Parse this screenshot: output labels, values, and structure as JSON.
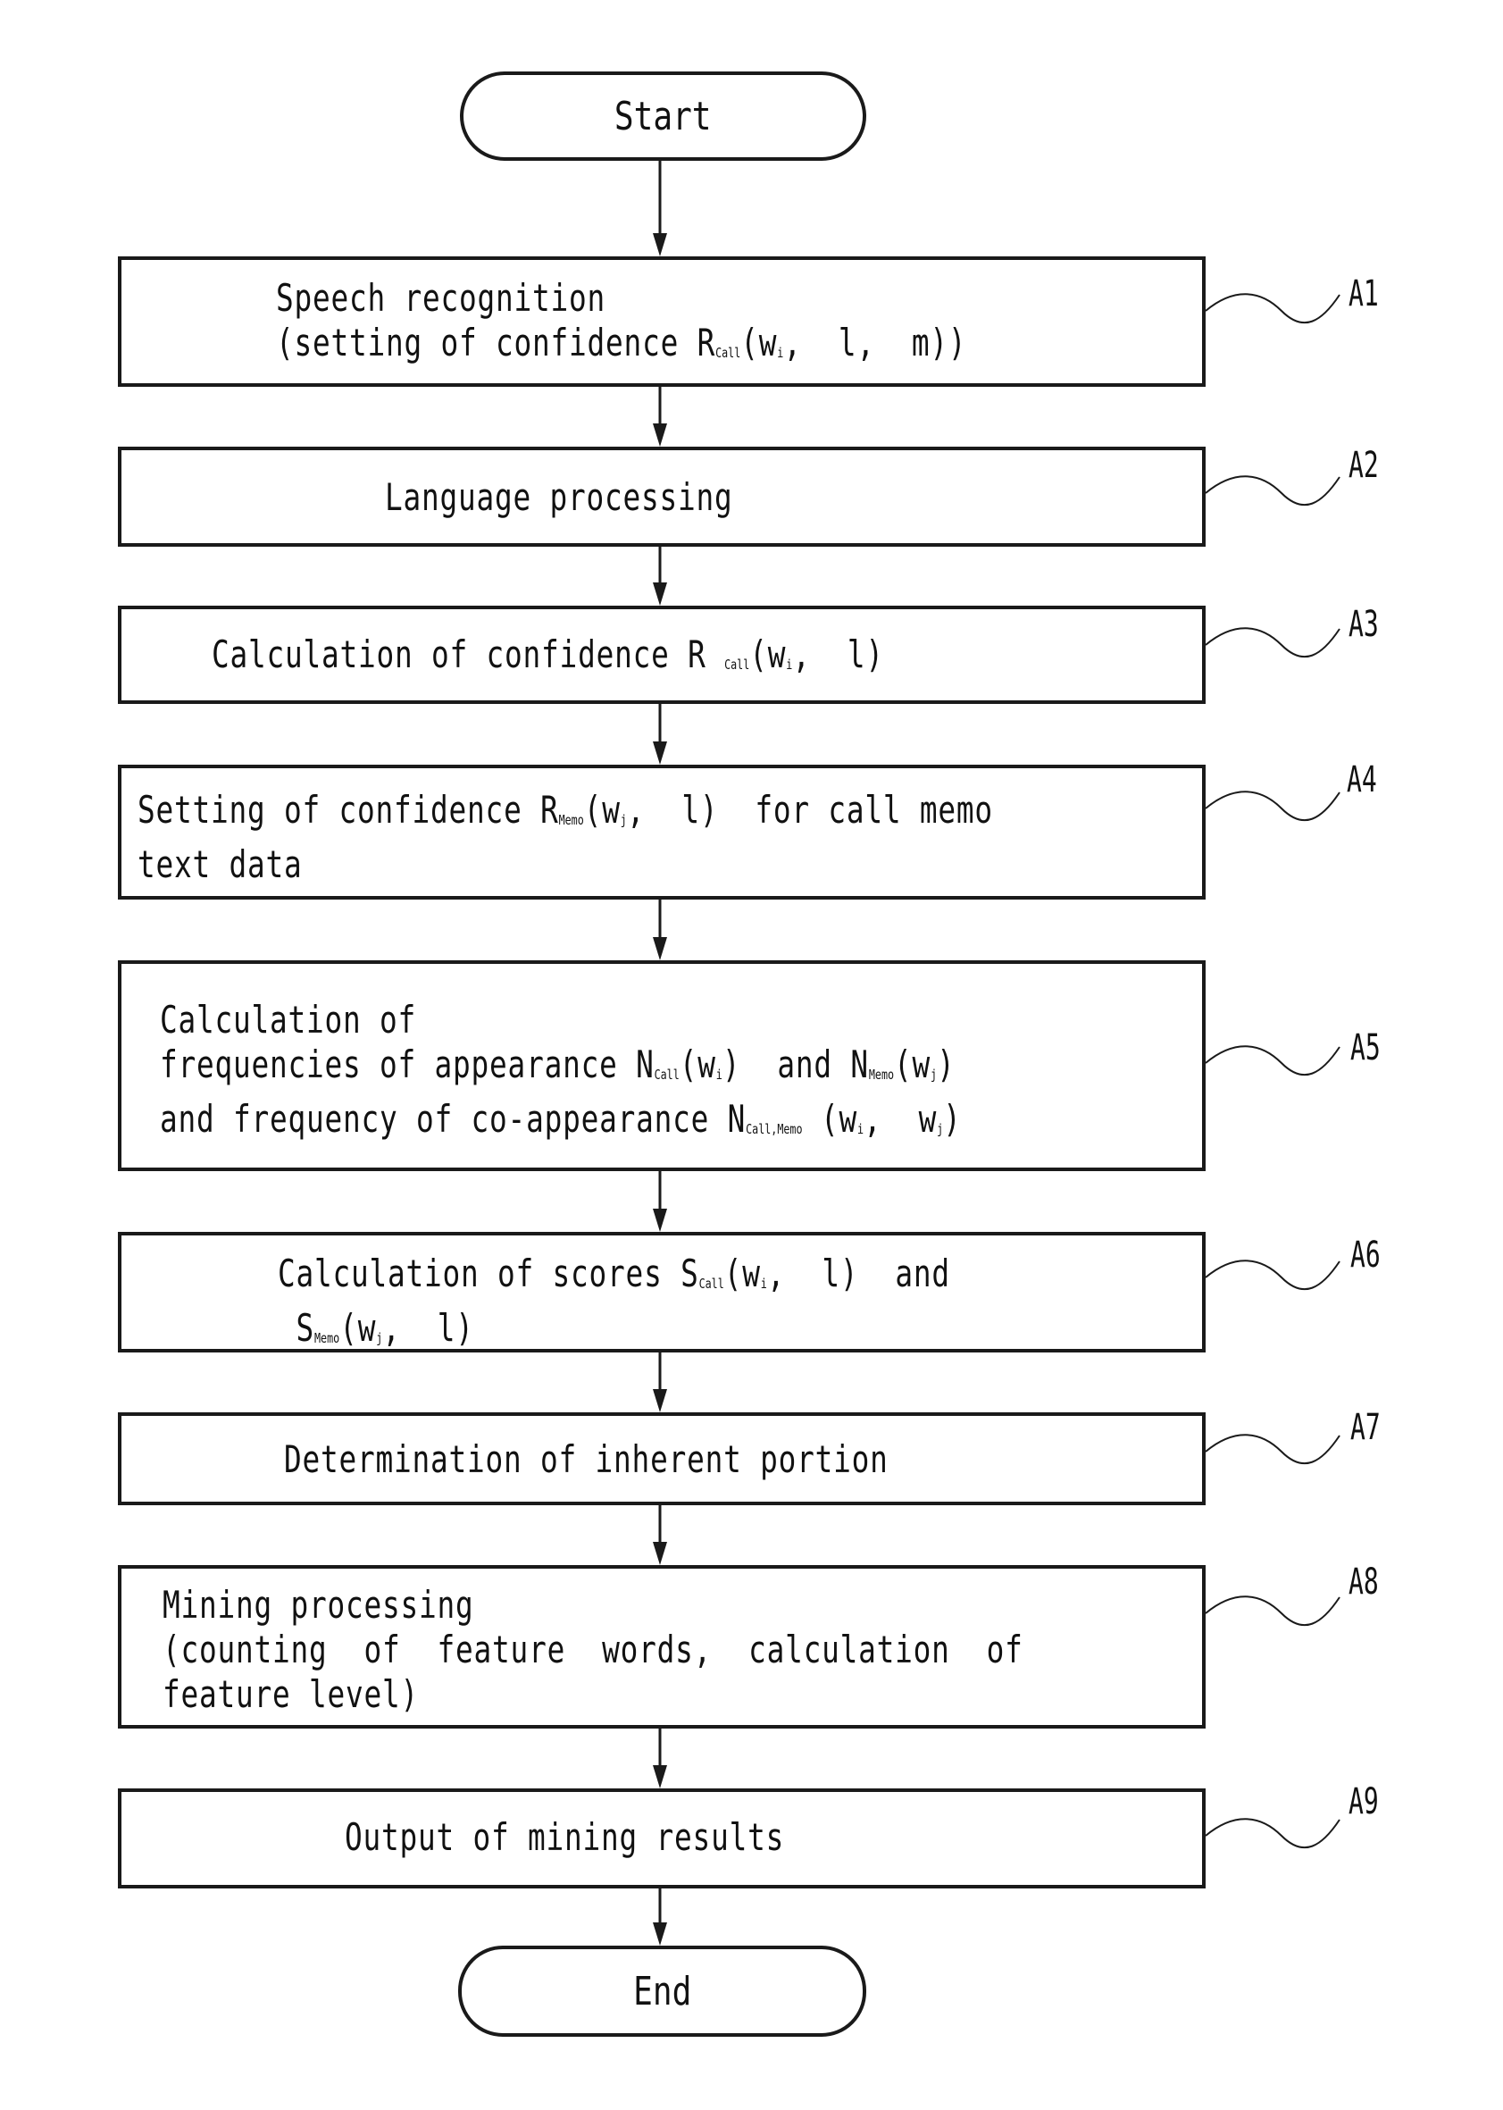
{
  "figure": {
    "terminals": {
      "start": "Start",
      "end": "End"
    },
    "steps": [
      {
        "id": "A1",
        "lines": [
          [
            {
              "t": "Speech recognition"
            }
          ],
          [
            {
              "t": "(setting of confidence R"
            },
            {
              "sub": "Call"
            },
            {
              "t": "(w"
            },
            {
              "sub": "i"
            },
            {
              "t": ",  l,  m))"
            }
          ]
        ]
      },
      {
        "id": "A2",
        "lines": [
          [
            {
              "t": "Language processing"
            }
          ]
        ]
      },
      {
        "id": "A3",
        "lines": [
          [
            {
              "t": "Calculation of confidence R "
            },
            {
              "sub": "Call"
            },
            {
              "t": "(w"
            },
            {
              "sub": "i"
            },
            {
              "t": ",  l)"
            }
          ]
        ]
      },
      {
        "id": "A4",
        "lines": [
          [
            {
              "t": "Setting of confidence R"
            },
            {
              "sub": "Memo"
            },
            {
              "t": "(w"
            },
            {
              "sub": "j"
            },
            {
              "t": ",  l)  for call memo"
            }
          ],
          [
            {
              "t": "text data"
            }
          ]
        ]
      },
      {
        "id": "A5",
        "lines": [
          [
            {
              "t": "Calculation of"
            }
          ],
          [
            {
              "t": "frequencies of appearance N"
            },
            {
              "sub": "Call"
            },
            {
              "t": "(w"
            },
            {
              "sub": "i"
            },
            {
              "t": ")  and N"
            },
            {
              "sub": "Memo"
            },
            {
              "t": "(w"
            },
            {
              "sub": "j"
            },
            {
              "t": ")"
            }
          ],
          [
            {
              "t": "and frequency of co-appearance N"
            },
            {
              "sub": "Call,Memo"
            },
            {
              "t": " (w"
            },
            {
              "sub": "i"
            },
            {
              "t": ",  w"
            },
            {
              "sub": "j"
            },
            {
              "t": ")"
            }
          ]
        ]
      },
      {
        "id": "A6",
        "lines": [
          [
            {
              "t": "Calculation of scores S"
            },
            {
              "sub": "Call"
            },
            {
              "t": "(w"
            },
            {
              "sub": "i"
            },
            {
              "t": ",  l)  and"
            }
          ],
          [
            {
              "t": " S"
            },
            {
              "sub": "Memo"
            },
            {
              "t": "(w"
            },
            {
              "sub": "j"
            },
            {
              "t": ",  l)"
            }
          ]
        ]
      },
      {
        "id": "A7",
        "lines": [
          [
            {
              "t": "Determination of inherent portion"
            }
          ]
        ]
      },
      {
        "id": "A8",
        "lines": [
          [
            {
              "t": "Mining processing"
            }
          ],
          [
            {
              "t": "(counting  of  feature  words,  calculation  of"
            }
          ],
          [
            {
              "t": "feature level)"
            }
          ]
        ]
      },
      {
        "id": "A9",
        "lines": [
          [
            {
              "t": "Output of mining results"
            }
          ]
        ]
      }
    ]
  }
}
